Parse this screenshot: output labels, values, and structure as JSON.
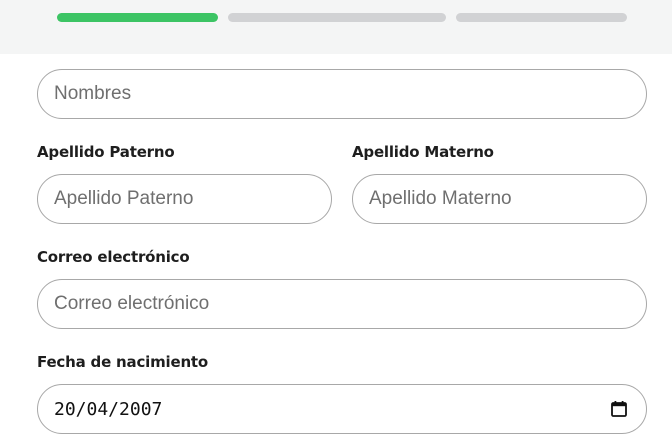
{
  "progress": {
    "steps_total": 3,
    "steps_completed": 1,
    "colors": {
      "done": "#3cc464",
      "todo": "#d1d2d4"
    }
  },
  "form": {
    "nombres": {
      "placeholder": "Nombres",
      "value": ""
    },
    "apellido_paterno": {
      "label": "Apellido Paterno",
      "placeholder": "Apellido Paterno",
      "value": ""
    },
    "apellido_materno": {
      "label": "Apellido Materno",
      "placeholder": "Apellido Materno",
      "value": ""
    },
    "correo": {
      "label": "Correo electrónico",
      "placeholder": "Correo electrónico",
      "value": ""
    },
    "fecha_nacimiento": {
      "label": "Fecha de nacimiento",
      "value": "20/04/2007",
      "icon": "calendar-icon"
    }
  }
}
